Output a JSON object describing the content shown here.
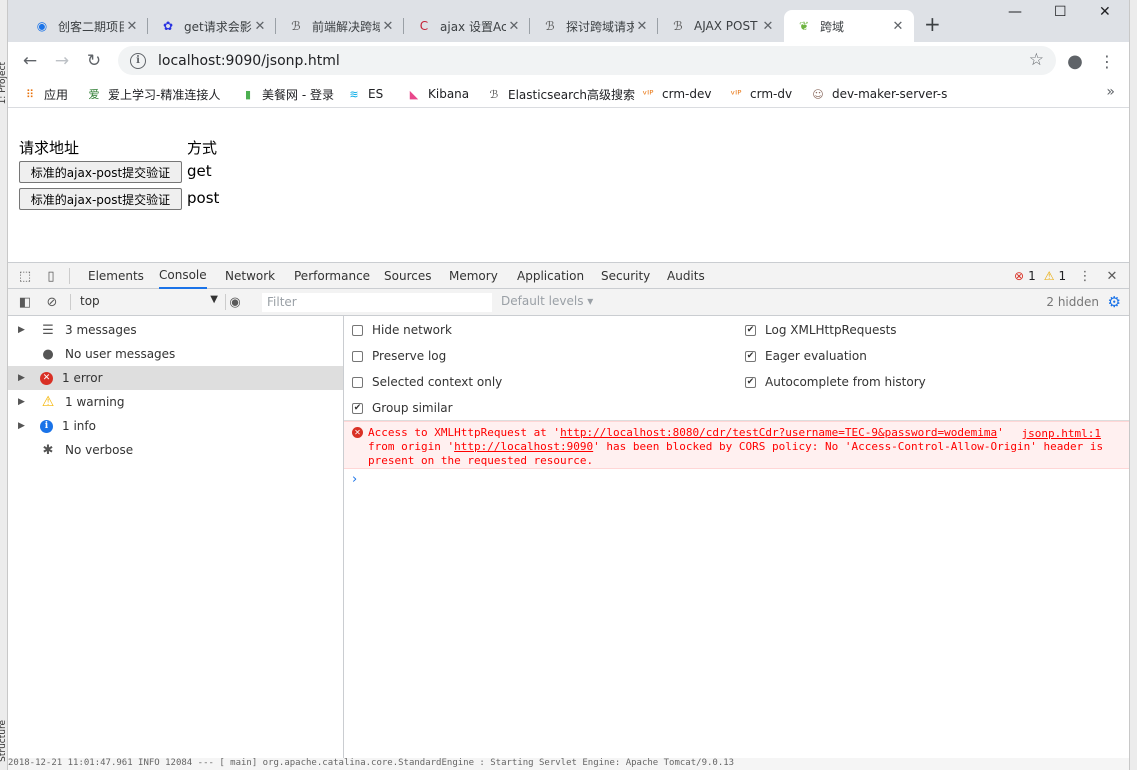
{
  "ide": {
    "left_label_top": "1: Project",
    "left_label_bottom": "Structure"
  },
  "tabs": [
    {
      "title": "创客二期项目",
      "icon": "globe-icon",
      "glyph": "◉",
      "color": "#1a73e8"
    },
    {
      "title": "get请求会影响",
      "icon": "baidu-paw-icon",
      "glyph": "✿",
      "color": "#2932e1"
    },
    {
      "title": "前端解决跨域",
      "icon": "custom-site-icon",
      "glyph": "ℬ",
      "color": "#555555"
    },
    {
      "title": "ajax 设置Access",
      "icon": "csdn-icon",
      "glyph": "C",
      "color": "#c32136"
    },
    {
      "title": "探讨跨域请求",
      "icon": "custom-site-icon",
      "glyph": "ℬ",
      "color": "#555555"
    },
    {
      "title": "AJAX POST",
      "icon": "custom-site-icon",
      "glyph": "ℬ",
      "color": "#555555"
    },
    {
      "title": "跨域",
      "icon": "spring-leaf-icon",
      "glyph": "❦",
      "color": "#6db33f",
      "active": true
    }
  ],
  "address": {
    "url": "localhost:9090/jsonp.html"
  },
  "bookmarks": [
    {
      "label": "应用",
      "icon": "apps-grid-icon",
      "glyph": "⠿",
      "color": "#e8710a"
    },
    {
      "label": "爱上学习-精准连接人",
      "icon": "ai-site-icon",
      "glyph": "爱",
      "color": "#2e7d32"
    },
    {
      "label": "美餐网 - 登录",
      "icon": "meican-icon",
      "glyph": "▮",
      "color": "#4caf50"
    },
    {
      "label": "ES",
      "icon": "elastic-icon",
      "glyph": "≋",
      "color": "#00a9e5"
    },
    {
      "label": "Kibana",
      "icon": "kibana-icon",
      "glyph": "◣",
      "color": "#e8478b"
    },
    {
      "label": "Elasticsearch高级搜索",
      "icon": "custom-site-icon",
      "glyph": "ℬ",
      "color": "#555555"
    },
    {
      "label": "crm-dev",
      "icon": "vip-icon",
      "glyph": "ᵛᴵᴾ",
      "color": "#e8710a"
    },
    {
      "label": "crm-dv",
      "icon": "vip-icon",
      "glyph": "ᵛᴵᴾ",
      "color": "#e8710a"
    },
    {
      "label": "dev-maker-server-s",
      "icon": "avatar-icon",
      "glyph": "☺",
      "color": "#8d6e63"
    }
  ],
  "page": {
    "header_url": "请求地址",
    "header_method": "方式",
    "rows": [
      {
        "button": "标准的ajax-post提交验证",
        "method": "get"
      },
      {
        "button": "标准的ajax-post提交验证",
        "method": "post"
      }
    ]
  },
  "devtools": {
    "tabs": [
      "Elements",
      "Console",
      "Network",
      "Performance",
      "Sources",
      "Memory",
      "Application",
      "Security",
      "Audits"
    ],
    "active_tab": "Console",
    "error_count": "1",
    "warning_count": "1",
    "context": "top",
    "filter_placeholder": "Filter",
    "levels": "Default levels",
    "hidden": "2 hidden"
  },
  "sidebar": [
    {
      "label": "3 messages",
      "icon": "list-icon",
      "expandable": true
    },
    {
      "label": "No user messages",
      "icon": "user-icon",
      "expandable": false
    },
    {
      "label": "1 error",
      "icon": "error-icon",
      "expandable": true,
      "selected": true
    },
    {
      "label": "1 warning",
      "icon": "warning-icon",
      "expandable": true
    },
    {
      "label": "1 info",
      "icon": "info-icon",
      "expandable": true
    },
    {
      "label": "No verbose",
      "icon": "bug-icon",
      "expandable": false
    }
  ],
  "settings": {
    "left": [
      {
        "label": "Hide network",
        "checked": false
      },
      {
        "label": "Preserve log",
        "checked": false
      },
      {
        "label": "Selected context only",
        "checked": false
      },
      {
        "label": "Group similar",
        "checked": true
      }
    ],
    "right": [
      {
        "label": "Log XMLHttpRequests",
        "checked": true
      },
      {
        "label": "Eager evaluation",
        "checked": true
      },
      {
        "label": "Autocomplete from history",
        "checked": true
      }
    ]
  },
  "error": {
    "l1_pre": "Access to XMLHttpRequest at '",
    "l1_url": "http://localhost:8080/cdr/testCdr?username=TEC-9&password=wodemima",
    "l1_post": "'",
    "l2_pre": "from origin '",
    "l2_url": "http://localhost:9090",
    "l2_post": "' has been blocked by CORS policy: No 'Access-Control-Allow-Origin' header is",
    "l3": "present on the requested resource.",
    "source": "jsonp.html:1"
  },
  "ide_log": "2018-12-21 11:01:47.961  INFO 12084 ---  [           main] org.apache.catalina.core.StandardEngine  : Starting Servlet Engine: Apache Tomcat/9.0.13"
}
